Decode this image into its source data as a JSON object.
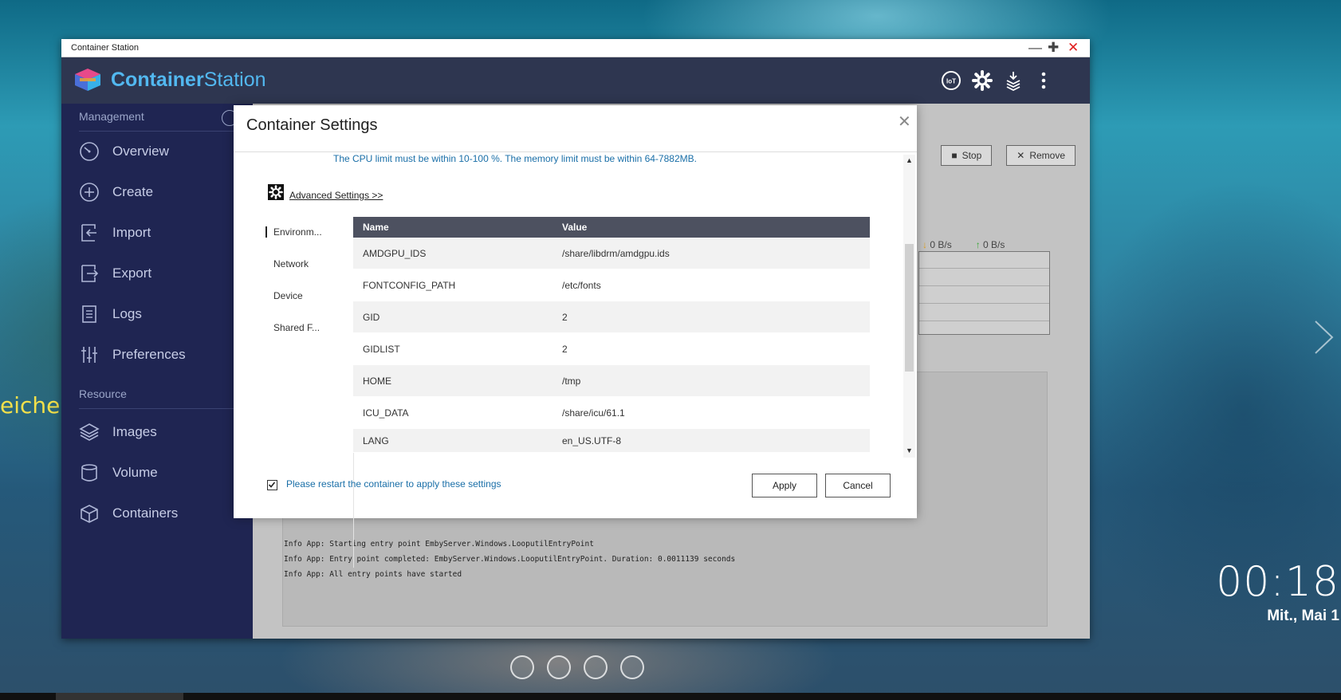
{
  "wallpaper": {
    "label_text": "eicher"
  },
  "clock": {
    "time": "00:18",
    "date": "Mit., Mai 1"
  },
  "window": {
    "title": "Container Station"
  },
  "brand": {
    "name_bold": "Container",
    "name_regular": "Station"
  },
  "sidebar": {
    "management_label": "Management",
    "resource_label": "Resource",
    "management_items": [
      {
        "label": "Overview",
        "icon": "gauge-icon"
      },
      {
        "label": "Create",
        "icon": "plus-circle-icon"
      },
      {
        "label": "Import",
        "icon": "import-icon"
      },
      {
        "label": "Export",
        "icon": "export-icon"
      },
      {
        "label": "Logs",
        "icon": "document-icon"
      },
      {
        "label": "Preferences",
        "icon": "sliders-icon"
      }
    ],
    "resource_items": [
      {
        "label": "Images",
        "icon": "layers-icon"
      },
      {
        "label": "Volume",
        "icon": "cylinder-icon"
      },
      {
        "label": "Containers",
        "icon": "cube-icon"
      }
    ]
  },
  "content": {
    "stop_label": "Stop",
    "remove_label": "Remove",
    "download_rate": "0 B/s",
    "upload_rate": "0 B/s",
    "log_lines": [
      "Info App: Starting entry point EmbyServer.Windows.LooputilEntryPoint",
      "Info App: Entry point completed: EmbyServer.Windows.LooputilEntryPoint. Duration: 0.0011139 seconds",
      "Info App: All entry points have started"
    ]
  },
  "modal": {
    "title": "Container Settings",
    "notice": "The CPU limit must be within 10-100 %. The memory limit must be within 64-7882MB.",
    "advanced_link": "Advanced Settings >>",
    "tabs": [
      "Environm...",
      "Network",
      "Device",
      "Shared F..."
    ],
    "table": {
      "col_name": "Name",
      "col_value": "Value",
      "rows": [
        {
          "name": "AMDGPU_IDS",
          "value": "/share/libdrm/amdgpu.ids"
        },
        {
          "name": "FONTCONFIG_PATH",
          "value": "/etc/fonts"
        },
        {
          "name": "GID",
          "value": "2"
        },
        {
          "name": "GIDLIST",
          "value": "2"
        },
        {
          "name": "HOME",
          "value": "/tmp"
        },
        {
          "name": "ICU_DATA",
          "value": "/share/icu/61.1"
        },
        {
          "name": "LANG",
          "value": "en_US.UTF-8"
        }
      ]
    },
    "restart_text": "Please restart the container to apply these settings",
    "restart_checked": true,
    "apply_label": "Apply",
    "cancel_label": "Cancel"
  }
}
